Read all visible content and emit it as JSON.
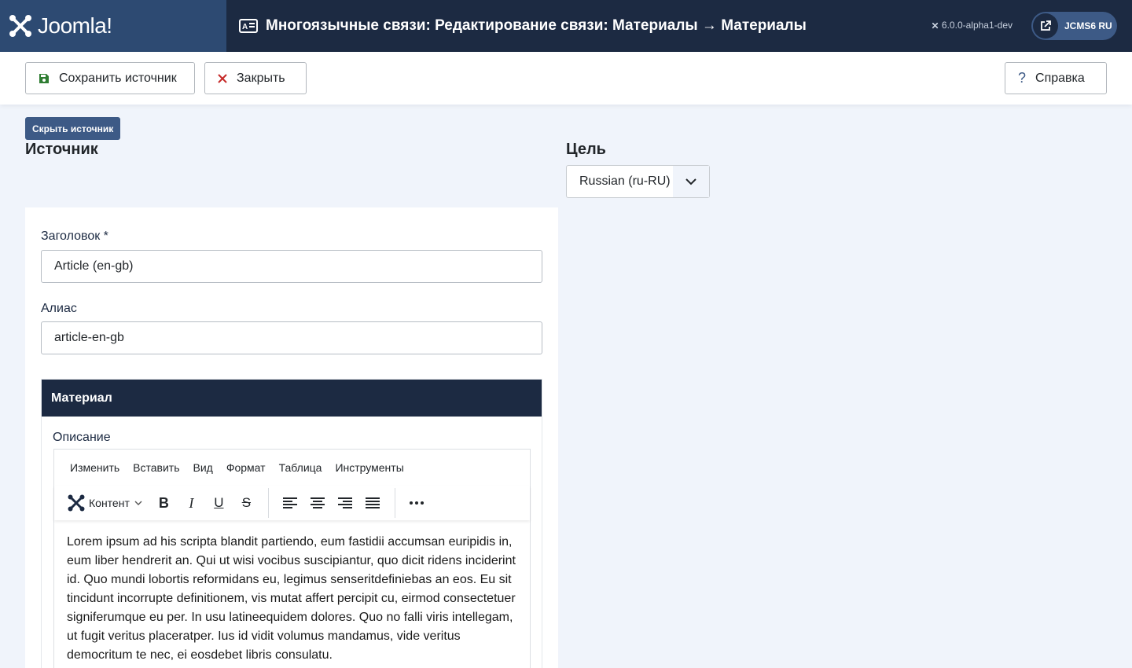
{
  "header": {
    "logo_text": "Joomla!",
    "title": "Многоязычные связи: Редактирование связи: Материалы → Материалы",
    "version": "6.0.0-alpha1-dev",
    "site_button": "JCMS6 RU",
    "colors": {
      "bar": "#1c2a42",
      "logo_bg": "#2d4a72",
      "accent": "#3d5a86"
    }
  },
  "toolbar": {
    "save_label": "Сохранить источник",
    "close_label": "Закрыть",
    "help_label": "Справка"
  },
  "source": {
    "toggle_label": "Скрыть источник",
    "heading": "Источник",
    "title_label": "Заголовок *",
    "title_value": "Article (en-gb)",
    "alias_label": "Алиас",
    "alias_value": "article-en-gb",
    "card_title": "Материал",
    "description_label": "Описание"
  },
  "target": {
    "heading": "Цель",
    "language": "Russian (ru-RU)"
  },
  "editor": {
    "menu": [
      "Изменить",
      "Вставить",
      "Вид",
      "Формат",
      "Таблица",
      "Инструменты"
    ],
    "format_label": "Контент",
    "text": "Lorem ipsum ad his scripta blandit partiendo, eum fastidii accumsan euripidis in, eum liber hendrerit an. Qui ut wisi vocibus suscipiantur, quo dicit ridens inciderint id. Quo mundi lobortis reformidans eu, legimus senseritdefiniebas an eos. Eu sit tincidunt incorrupte definitionem, vis mutat affert percipit cu, eirmod consectetuer signiferumque eu per. In usu latineequidem dolores. Quo no falli viris intellegam, ut fugit veritus placeratper. Ius id vidit volumus mandamus, vide veritus democritum te nec, ei eosdebet libris consulatu."
  }
}
